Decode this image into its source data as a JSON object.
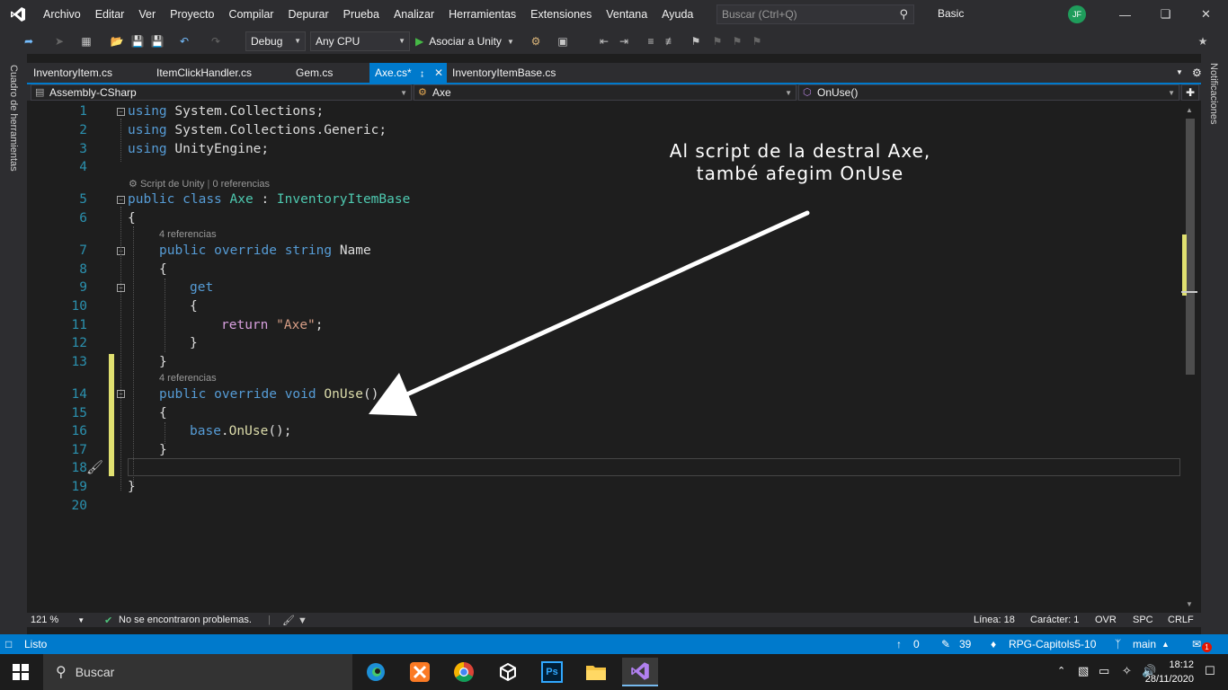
{
  "menubar": {
    "items": [
      "Archivo",
      "Editar",
      "Ver",
      "Proyecto",
      "Compilar",
      "Depurar",
      "Prueba",
      "Analizar",
      "Herramientas",
      "Extensiones",
      "Ventana",
      "Ayuda"
    ],
    "search_placeholder": "Buscar (Ctrl+Q)",
    "profile": "Basic",
    "user_initials": "JF"
  },
  "toolbar": {
    "config": "Debug",
    "platform": "Any CPU",
    "attach": "Asociar a Unity"
  },
  "sidebars": {
    "left": "Cuadro de herramientas",
    "right": "Notificaciones"
  },
  "tabs": [
    {
      "label": "InventoryItem.cs"
    },
    {
      "label": "ItemClickHandler.cs"
    },
    {
      "label": "Gem.cs"
    },
    {
      "label": "Axe.cs*"
    },
    {
      "label": "InventoryItemBase.cs"
    }
  ],
  "navbar": {
    "project": "Assembly-CSharp",
    "class": "Axe",
    "member": "OnUse()"
  },
  "editor": {
    "line_numbers": [
      "1",
      "2",
      "3",
      "4",
      "5",
      "6",
      "7",
      "8",
      "9",
      "10",
      "11",
      "12",
      "13",
      "14",
      "15",
      "16",
      "17",
      "18",
      "19",
      "20"
    ],
    "lines": {
      "l1": [
        "using",
        " System.Collections;"
      ],
      "l2": [
        "using",
        " System.Collections.Generic;"
      ],
      "l3": [
        "using",
        " UnityEngine;"
      ],
      "l5": [
        "public",
        " ",
        "class",
        " ",
        "Axe",
        " : ",
        "InventoryItemBase"
      ],
      "l6": "{",
      "l7": [
        "public",
        " ",
        "override",
        " ",
        "string",
        " Name"
      ],
      "l8": "{",
      "l9": "get",
      "l10": "{",
      "l11": [
        "return",
        " ",
        "\"Axe\"",
        ";"
      ],
      "l12": "}",
      "l13": "}",
      "l14": [
        "public",
        " ",
        "override",
        " ",
        "void",
        " ",
        "OnUse",
        "()"
      ],
      "l15": "{",
      "l16": [
        "base",
        ".",
        "OnUse",
        "();"
      ],
      "l17": "}",
      "l19": "}"
    },
    "lens": {
      "class_prefix": "Script de Unity",
      "class_refs": "0 referencias",
      "name_refs": "4 referencias",
      "onuse_refs": "4 referencias"
    },
    "annotation": {
      "line1": "Al script de la destral Axe,",
      "line2": "també afegim OnUse"
    }
  },
  "editor_status": {
    "zoom": "121 %",
    "issues": "No se encontraron problemas.",
    "line": "Línea: 18",
    "char": "Carácter: 1",
    "ovr": "OVR",
    "spc": "SPC",
    "eol": "CRLF"
  },
  "statusbar": {
    "ready": "Listo",
    "up_count": "0",
    "pending_changes": "39",
    "repo": "RPG-Capitols5-10",
    "branch": "main",
    "notifications": "1"
  },
  "taskbar": {
    "search": "Buscar",
    "time": "18:12",
    "date": "28/11/2020",
    "apps": [
      "edge-icon",
      "xampp-icon",
      "chrome-icon",
      "unity-icon",
      "photoshop-icon",
      "explorer-icon",
      "visual-studio-icon"
    ],
    "ps_label": "Ps"
  },
  "colors": {
    "accent": "#007acc",
    "keyword": "#569cd6",
    "type": "#4ec9b0",
    "string": "#d69d85",
    "control": "#d8a0df",
    "method": "#dcdcaa",
    "line_number": "#2b91af",
    "change_marker": "#e0e070"
  }
}
